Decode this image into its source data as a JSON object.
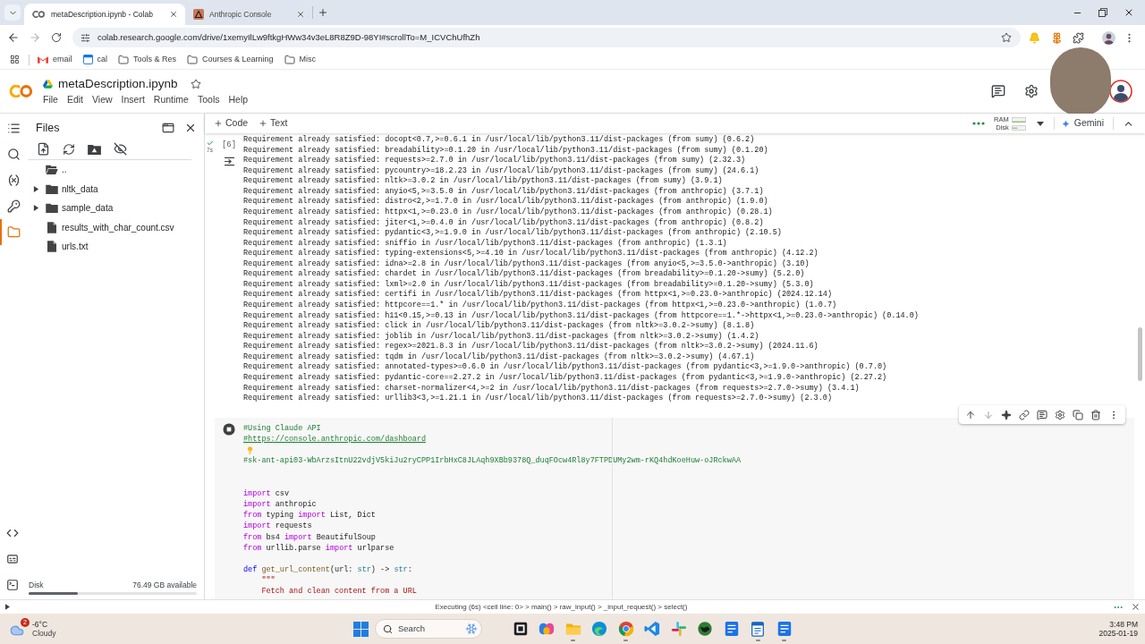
{
  "browser": {
    "tabs": [
      {
        "title": "metaDescription.ipynb - Colab",
        "kind": "colab",
        "selected": true
      },
      {
        "title": "Anthropic Console",
        "kind": "anthropic",
        "selected": false
      }
    ],
    "url": "colab.research.google.com/drive/1xemyIlLw9ftkgHWw34v3eL8R8Z9D-98YI#scrollTo=M_ICVChUfhZh",
    "bookmarks": [
      {
        "label": "email",
        "kind": "gmail"
      },
      {
        "label": "cal",
        "kind": "calendar"
      },
      {
        "label": "Tools & Res",
        "kind": "folder"
      },
      {
        "label": "Courses & Learning",
        "kind": "folder"
      },
      {
        "label": "Misc",
        "kind": "folder"
      }
    ]
  },
  "notebook": {
    "title": "metaDescription.ipynb",
    "starred": false,
    "menu": [
      "File",
      "Edit",
      "View",
      "Insert",
      "Runtime",
      "Tools",
      "Help"
    ]
  },
  "toolbar": {
    "add": [
      "Code",
      "Text"
    ],
    "ram_label": "RAM",
    "disk_label": "Disk",
    "assistant": "Gemini"
  },
  "sidebar": {
    "activity": [
      {
        "kind": "toc",
        "selected": false
      },
      {
        "kind": "search",
        "selected": false
      },
      {
        "kind": "variables",
        "selected": false
      },
      {
        "kind": "secrets",
        "selected": false
      },
      {
        "kind": "files",
        "selected": true
      }
    ],
    "files": {
      "title": "Files",
      "items": [
        {
          "name": "..",
          "kind": "parent"
        },
        {
          "name": "nltk_data",
          "kind": "folder",
          "expanded": false
        },
        {
          "name": "sample_data",
          "kind": "folder",
          "expanded": false
        },
        {
          "name": "results_with_char_count.csv",
          "kind": "file"
        },
        {
          "name": "urls.txt",
          "kind": "file"
        }
      ],
      "disk": {
        "label": "Disk",
        "reading": "76.49 GB available",
        "level": 0.29
      }
    }
  },
  "cells": [
    {
      "kind": "output",
      "timing": "7s",
      "count": "[6]",
      "lines": [
        "Requirement already satisfied: docopt<0.7,>=0.6.1 in /usr/local/lib/python3.11/dist-packages (from sumy) (0.6.2)",
        "Requirement already satisfied: breadability>=0.1.20 in /usr/local/lib/python3.11/dist-packages (from sumy) (0.1.20)",
        "Requirement already satisfied: requests>=2.7.0 in /usr/local/lib/python3.11/dist-packages (from sumy) (2.32.3)",
        "Requirement already satisfied: pycountry>=18.2.23 in /usr/local/lib/python3.11/dist-packages (from sumy) (24.6.1)",
        "Requirement already satisfied: nltk>=3.0.2 in /usr/local/lib/python3.11/dist-packages (from sumy) (3.9.1)",
        "Requirement already satisfied: anyio<5,>=3.5.0 in /usr/local/lib/python3.11/dist-packages (from anthropic) (3.7.1)",
        "Requirement already satisfied: distro<2,>=1.7.0 in /usr/local/lib/python3.11/dist-packages (from anthropic) (1.9.0)",
        "Requirement already satisfied: httpx<1,>=0.23.0 in /usr/local/lib/python3.11/dist-packages (from anthropic) (0.28.1)",
        "Requirement already satisfied: jiter<1,>=0.4.0 in /usr/local/lib/python3.11/dist-packages (from anthropic) (0.8.2)",
        "Requirement already satisfied: pydantic<3,>=1.9.0 in /usr/local/lib/python3.11/dist-packages (from anthropic) (2.10.5)",
        "Requirement already satisfied: sniffio in /usr/local/lib/python3.11/dist-packages (from anthropic) (1.3.1)",
        "Requirement already satisfied: typing-extensions<5,>=4.10 in /usr/local/lib/python3.11/dist-packages (from anthropic) (4.12.2)",
        "Requirement already satisfied: idna>=2.8 in /usr/local/lib/python3.11/dist-packages (from anyio<5,>=3.5.0->anthropic) (3.10)",
        "Requirement already satisfied: chardet in /usr/local/lib/python3.11/dist-packages (from breadability>=0.1.20->sumy) (5.2.0)",
        "Requirement already satisfied: lxml>=2.0 in /usr/local/lib/python3.11/dist-packages (from breadability>=0.1.20->sumy) (5.3.0)",
        "Requirement already satisfied: certifi in /usr/local/lib/python3.11/dist-packages (from httpx<1,>=0.23.0->anthropic) (2024.12.14)",
        "Requirement already satisfied: httpcore==1.* in /usr/local/lib/python3.11/dist-packages (from httpx<1,>=0.23.0->anthropic) (1.0.7)",
        "Requirement already satisfied: h11<0.15,>=0.13 in /usr/local/lib/python3.11/dist-packages (from httpcore==1.*->httpx<1,>=0.23.0->anthropic) (0.14.0)",
        "Requirement already satisfied: click in /usr/local/lib/python3.11/dist-packages (from nltk>=3.0.2->sumy) (8.1.8)",
        "Requirement already satisfied: joblib in /usr/local/lib/python3.11/dist-packages (from nltk>=3.0.2->sumy) (1.4.2)",
        "Requirement already satisfied: regex>=2021.8.3 in /usr/local/lib/python3.11/dist-packages (from nltk>=3.0.2->sumy) (2024.11.6)",
        "Requirement already satisfied: tqdm in /usr/local/lib/python3.11/dist-packages (from nltk>=3.0.2->sumy) (4.67.1)",
        "Requirement already satisfied: annotated-types>=0.6.0 in /usr/local/lib/python3.11/dist-packages (from pydantic<3,>=1.9.0->anthropic) (0.7.0)",
        "Requirement already satisfied: pydantic-core==2.27.2 in /usr/local/lib/python3.11/dist-packages (from pydantic<3,>=1.9.0->anthropic) (2.27.2)",
        "Requirement already satisfied: charset-normalizer<4,>=2 in /usr/local/lib/python3.11/dist-packages (from requests>=2.7.0->sumy) (3.4.1)",
        "Requirement already satisfied: urllib3<3,>=1.21.1 in /usr/local/lib/python3.11/dist-packages (from requests>=2.7.0->sumy) (2.3.0)"
      ]
    },
    {
      "kind": "code",
      "running": true,
      "lines": [
        {
          "kind": "code",
          "tokens": [
            {
              "kind": "comment",
              "text": "#Using Claude API"
            }
          ]
        },
        {
          "kind": "code",
          "tokens": [
            {
              "kind": "link",
              "text": "#https://console.anthropic.com/dashboard"
            }
          ]
        },
        {
          "kind": "hint"
        },
        {
          "kind": "code",
          "tokens": [
            {
              "kind": "comment",
              "text": "#sk-ant-api03-WbArzsItnU22vdjV5kiJu2ryCPP1IrbHxC8JLAqh9XBb9378Q_duqFOcw4Rl8y7FTPDUMy2wm-rKQ4hdKoeHuw-oJRckwAA"
            }
          ]
        },
        {
          "kind": "blank"
        },
        {
          "kind": "blank"
        },
        {
          "kind": "code",
          "tokens": [
            {
              "kind": "keyword",
              "text": "import"
            },
            {
              "kind": "plain",
              "text": " csv"
            }
          ]
        },
        {
          "kind": "code",
          "tokens": [
            {
              "kind": "keyword",
              "text": "import"
            },
            {
              "kind": "plain",
              "text": " anthropic"
            }
          ]
        },
        {
          "kind": "code",
          "tokens": [
            {
              "kind": "keyword",
              "text": "from"
            },
            {
              "kind": "plain",
              "text": " typing "
            },
            {
              "kind": "keyword",
              "text": "import"
            },
            {
              "kind": "plain",
              "text": " List, Dict"
            }
          ]
        },
        {
          "kind": "code",
          "tokens": [
            {
              "kind": "keyword",
              "text": "import"
            },
            {
              "kind": "plain",
              "text": " requests"
            }
          ]
        },
        {
          "kind": "code",
          "tokens": [
            {
              "kind": "keyword",
              "text": "from"
            },
            {
              "kind": "plain",
              "text": " bs4 "
            },
            {
              "kind": "keyword",
              "text": "import"
            },
            {
              "kind": "plain",
              "text": " BeautifulSoup"
            }
          ]
        },
        {
          "kind": "code",
          "tokens": [
            {
              "kind": "keyword",
              "text": "from"
            },
            {
              "kind": "plain",
              "text": " urllib.parse "
            },
            {
              "kind": "keyword",
              "text": "import"
            },
            {
              "kind": "plain",
              "text": " urlparse"
            }
          ]
        },
        {
          "kind": "blank"
        },
        {
          "kind": "code",
          "tokens": [
            {
              "kind": "def",
              "text": "def"
            },
            {
              "kind": "function",
              "text": " get_url_content"
            },
            {
              "kind": "plain",
              "text": "(url: "
            },
            {
              "kind": "type",
              "text": "str"
            },
            {
              "kind": "plain",
              "text": ") -> "
            },
            {
              "kind": "type",
              "text": "str"
            },
            {
              "kind": "plain",
              "text": ":"
            }
          ]
        },
        {
          "kind": "code",
          "tokens": [
            {
              "kind": "string",
              "text": "    \"\"\""
            }
          ]
        },
        {
          "kind": "code",
          "tokens": [
            {
              "kind": "string",
              "text": "    Fetch and clean content from a URL"
            }
          ]
        }
      ]
    }
  ],
  "status_bar": {
    "text": "Executing (6s) <cell line: 0> > main() > raw_input() > _input_request() > select()"
  },
  "taskbar": {
    "weather": {
      "badge": "2",
      "temperature": "-6°C",
      "condition": "Cloudy"
    },
    "search": {
      "placeholder": "Search"
    },
    "apps": [
      {
        "kind": "taskview",
        "running": false
      },
      {
        "kind": "assistant",
        "running": false
      },
      {
        "kind": "explorer",
        "running": true
      },
      {
        "kind": "edge",
        "running": false
      },
      {
        "kind": "chrome",
        "running": true
      },
      {
        "kind": "vscode",
        "running": false
      },
      {
        "kind": "slack",
        "running": false
      },
      {
        "kind": "globe",
        "running": false
      },
      {
        "kind": "document",
        "running": false
      },
      {
        "kind": "notepad",
        "running": true
      },
      {
        "kind": "document",
        "running": true
      }
    ],
    "time": "3:48 PM",
    "date": "2025-01-19"
  }
}
